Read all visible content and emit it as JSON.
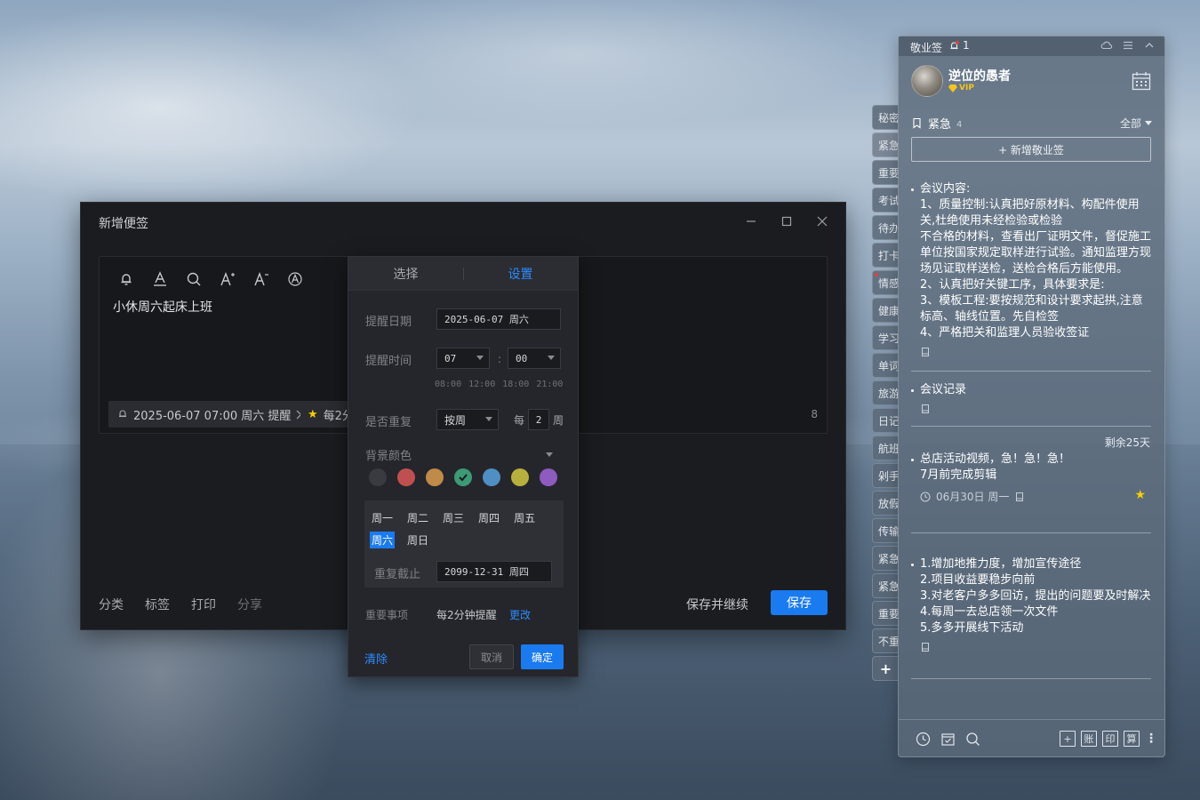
{
  "editor": {
    "title": "新增便签",
    "note_text": "小休周六起床上班",
    "reminder_chip": "2025-06-07 07:00 周六 提醒",
    "priority_chip": "每2分",
    "char_count": "8",
    "footer_links": [
      "分类",
      "标签",
      "打印",
      "分享"
    ],
    "save_continue": "保存并继续",
    "save": "保存"
  },
  "popup": {
    "tabs": [
      "选择",
      "设置"
    ],
    "active_tab": "设置",
    "date_label": "提醒日期",
    "date_value": "2025-06-07  周六",
    "time_label": "提醒时间",
    "hour": "07",
    "minute": "00",
    "quick_times": [
      "08:00",
      "12:00",
      "18:00",
      "21:00"
    ],
    "repeat_label": "是否重复",
    "repeat_mode": "按周",
    "every": "每",
    "interval": "2",
    "week_unit": "周",
    "bg_label": "背景颜色",
    "colors": [
      "#3a3b40",
      "#c0504f",
      "#c08a48",
      "#3c9a74",
      "#4f8fc3",
      "#b7b03c",
      "#8e5bbf"
    ],
    "selected_color_index": 3,
    "weekdays": [
      "周一",
      "周二",
      "周三",
      "周四",
      "周五",
      "周六",
      "周日"
    ],
    "selected_weekday": "周六",
    "repeat_end_label": "重复截止",
    "repeat_end_value": "2099-12-31  周四",
    "important_label": "重要事项",
    "important_value": "每2分钟提醒",
    "change": "更改",
    "clear": "清除",
    "cancel": "取消",
    "ok": "确定"
  },
  "side_tabs": [
    "秘密",
    "紧急",
    "重要",
    "考试",
    "待办",
    "打卡",
    "情感",
    "健康",
    "学习",
    "单词",
    "旅游",
    "日记",
    "航班",
    "剁手",
    "放假",
    "传输",
    "紧急",
    "紧急",
    "重要",
    "不重"
  ],
  "side_tab_active_index": 1,
  "panel": {
    "title": "敬业签",
    "bell_count": "1",
    "username": "逆位的愚者",
    "vip": "VIP",
    "category": "紧急",
    "category_count": "4",
    "filter": "全部",
    "new_note": "+ 新增敬业签",
    "notes": [
      {
        "text": "会议内容:\n1、质量控制:认真把好原材料、构配件使用关,杜绝使用未经检验或检验\n不合格的材料，查看出厂证明文件，督促施工单位按国家规定取样进行试验。通知监理方现场见证取样送检，送检合格后方能使用。\n2、认真把好关键工序，具体要求是:\n3、模板工程:要按规范和设计要求起拱,注意标高、轴线位置。先自检签\n4、严格把关和监理人员验收签证"
      },
      {
        "text": "会议记录"
      },
      {
        "days_left": "剩余25天",
        "text": "总店活动视频，急！急！急！\n7月前完成剪辑",
        "date": "06月30日 周一"
      },
      {
        "text": "1.增加地推力度，增加宣传途径\n2.项目收益要稳步向前\n3.对老客户多多回访，提出的问题要及时解决\n4.每周一去总店领一次文件\n5.多多开展线下活动"
      }
    ],
    "footer_boxes": [
      "+",
      "账",
      "印",
      "算"
    ]
  }
}
